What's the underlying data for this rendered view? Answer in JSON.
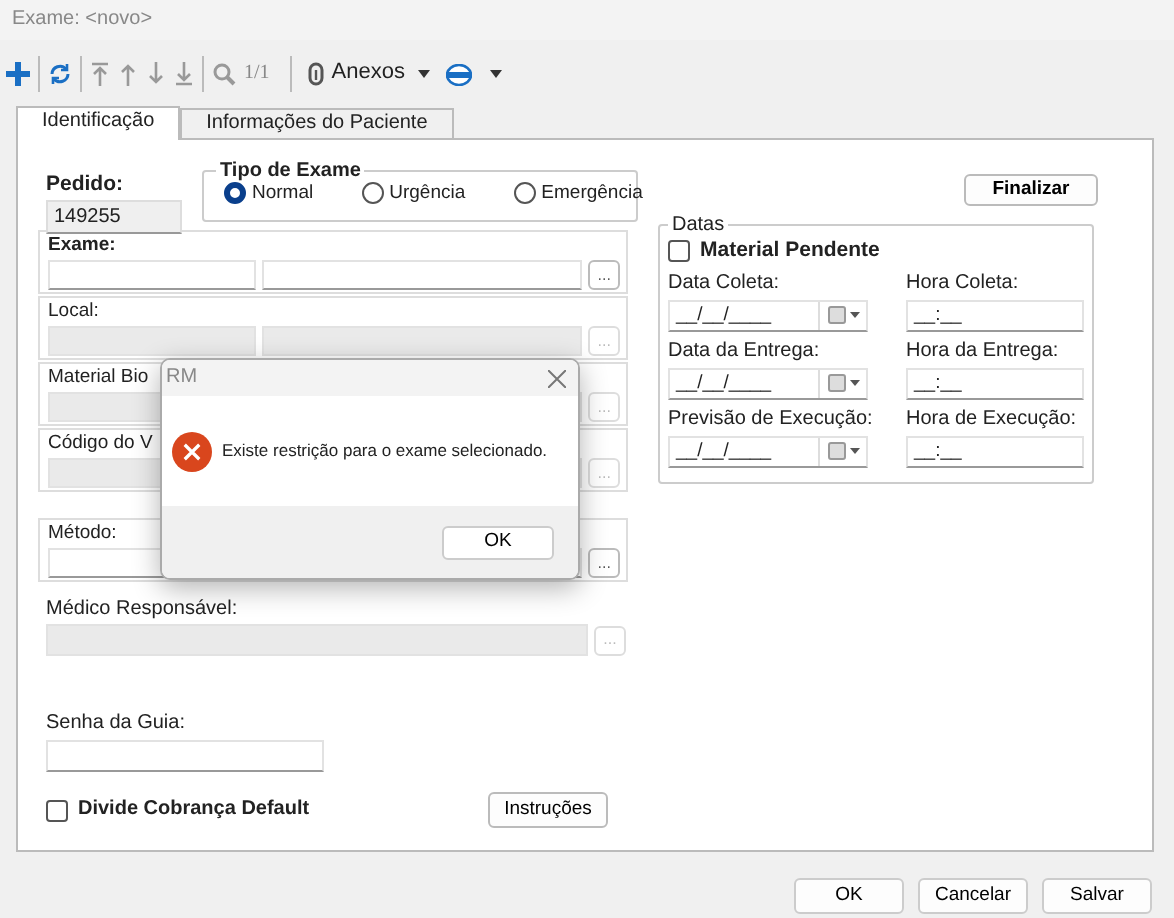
{
  "window": {
    "title": "Exame: <novo>"
  },
  "toolbar": {
    "record_count": "1/1",
    "attachments_label": "Anexos"
  },
  "tabs": [
    {
      "label": "Identificação",
      "selected": true
    },
    {
      "label": "Informações do Paciente",
      "selected": false
    }
  ],
  "pedido": {
    "label": "Pedido:",
    "value": "149255"
  },
  "tipo_exame": {
    "title": "Tipo de Exame",
    "options": [
      {
        "label": "Normal",
        "selected": true
      },
      {
        "label": "Urgência",
        "selected": false
      },
      {
        "label": "Emergência",
        "selected": false
      }
    ]
  },
  "sections": [
    {
      "label": "Exame:",
      "bold": true,
      "disabled": false,
      "browse": "..."
    },
    {
      "label": "Local:",
      "bold": false,
      "disabled": true,
      "browse": "..."
    },
    {
      "label": "Material Bio",
      "bold": false,
      "disabled": true,
      "browse": "..."
    },
    {
      "label": "Código do V",
      "bold": false,
      "disabled": true,
      "browse": "..."
    },
    {
      "label": "Método:",
      "bold": false,
      "disabled": false,
      "browse": "..."
    }
  ],
  "medico": {
    "label": "Médico Responsável:",
    "disabled": true,
    "browse": "..."
  },
  "senha": {
    "label": "Senha da Guia:"
  },
  "divide_cobranca": {
    "label": "Divide Cobrança Default",
    "checked": false
  },
  "instrucoes_button": "Instruções",
  "finalizar_button": "Finalizar",
  "datas": {
    "title": "Datas",
    "material_pendente": {
      "label": "Material Pendente",
      "checked": false
    },
    "rows": [
      {
        "date_label": "Data Coleta:",
        "date_value": "__/__/____",
        "time_label": "Hora Coleta:",
        "time_value": "__:__"
      },
      {
        "date_label": "Data da Entrega:",
        "date_value": "__/__/____",
        "time_label": "Hora da Entrega:",
        "time_value": "__:__"
      },
      {
        "date_label": "Previsão de Execução:",
        "date_value": "__/__/____",
        "time_label": "Hora de Execução:",
        "time_value": "__:__"
      }
    ]
  },
  "footer_buttons": [
    "OK",
    "Cancelar",
    "Salvar"
  ],
  "dialog": {
    "title": "RM",
    "message": "Existe restrição para o exame selecionado.",
    "button": "OK"
  }
}
